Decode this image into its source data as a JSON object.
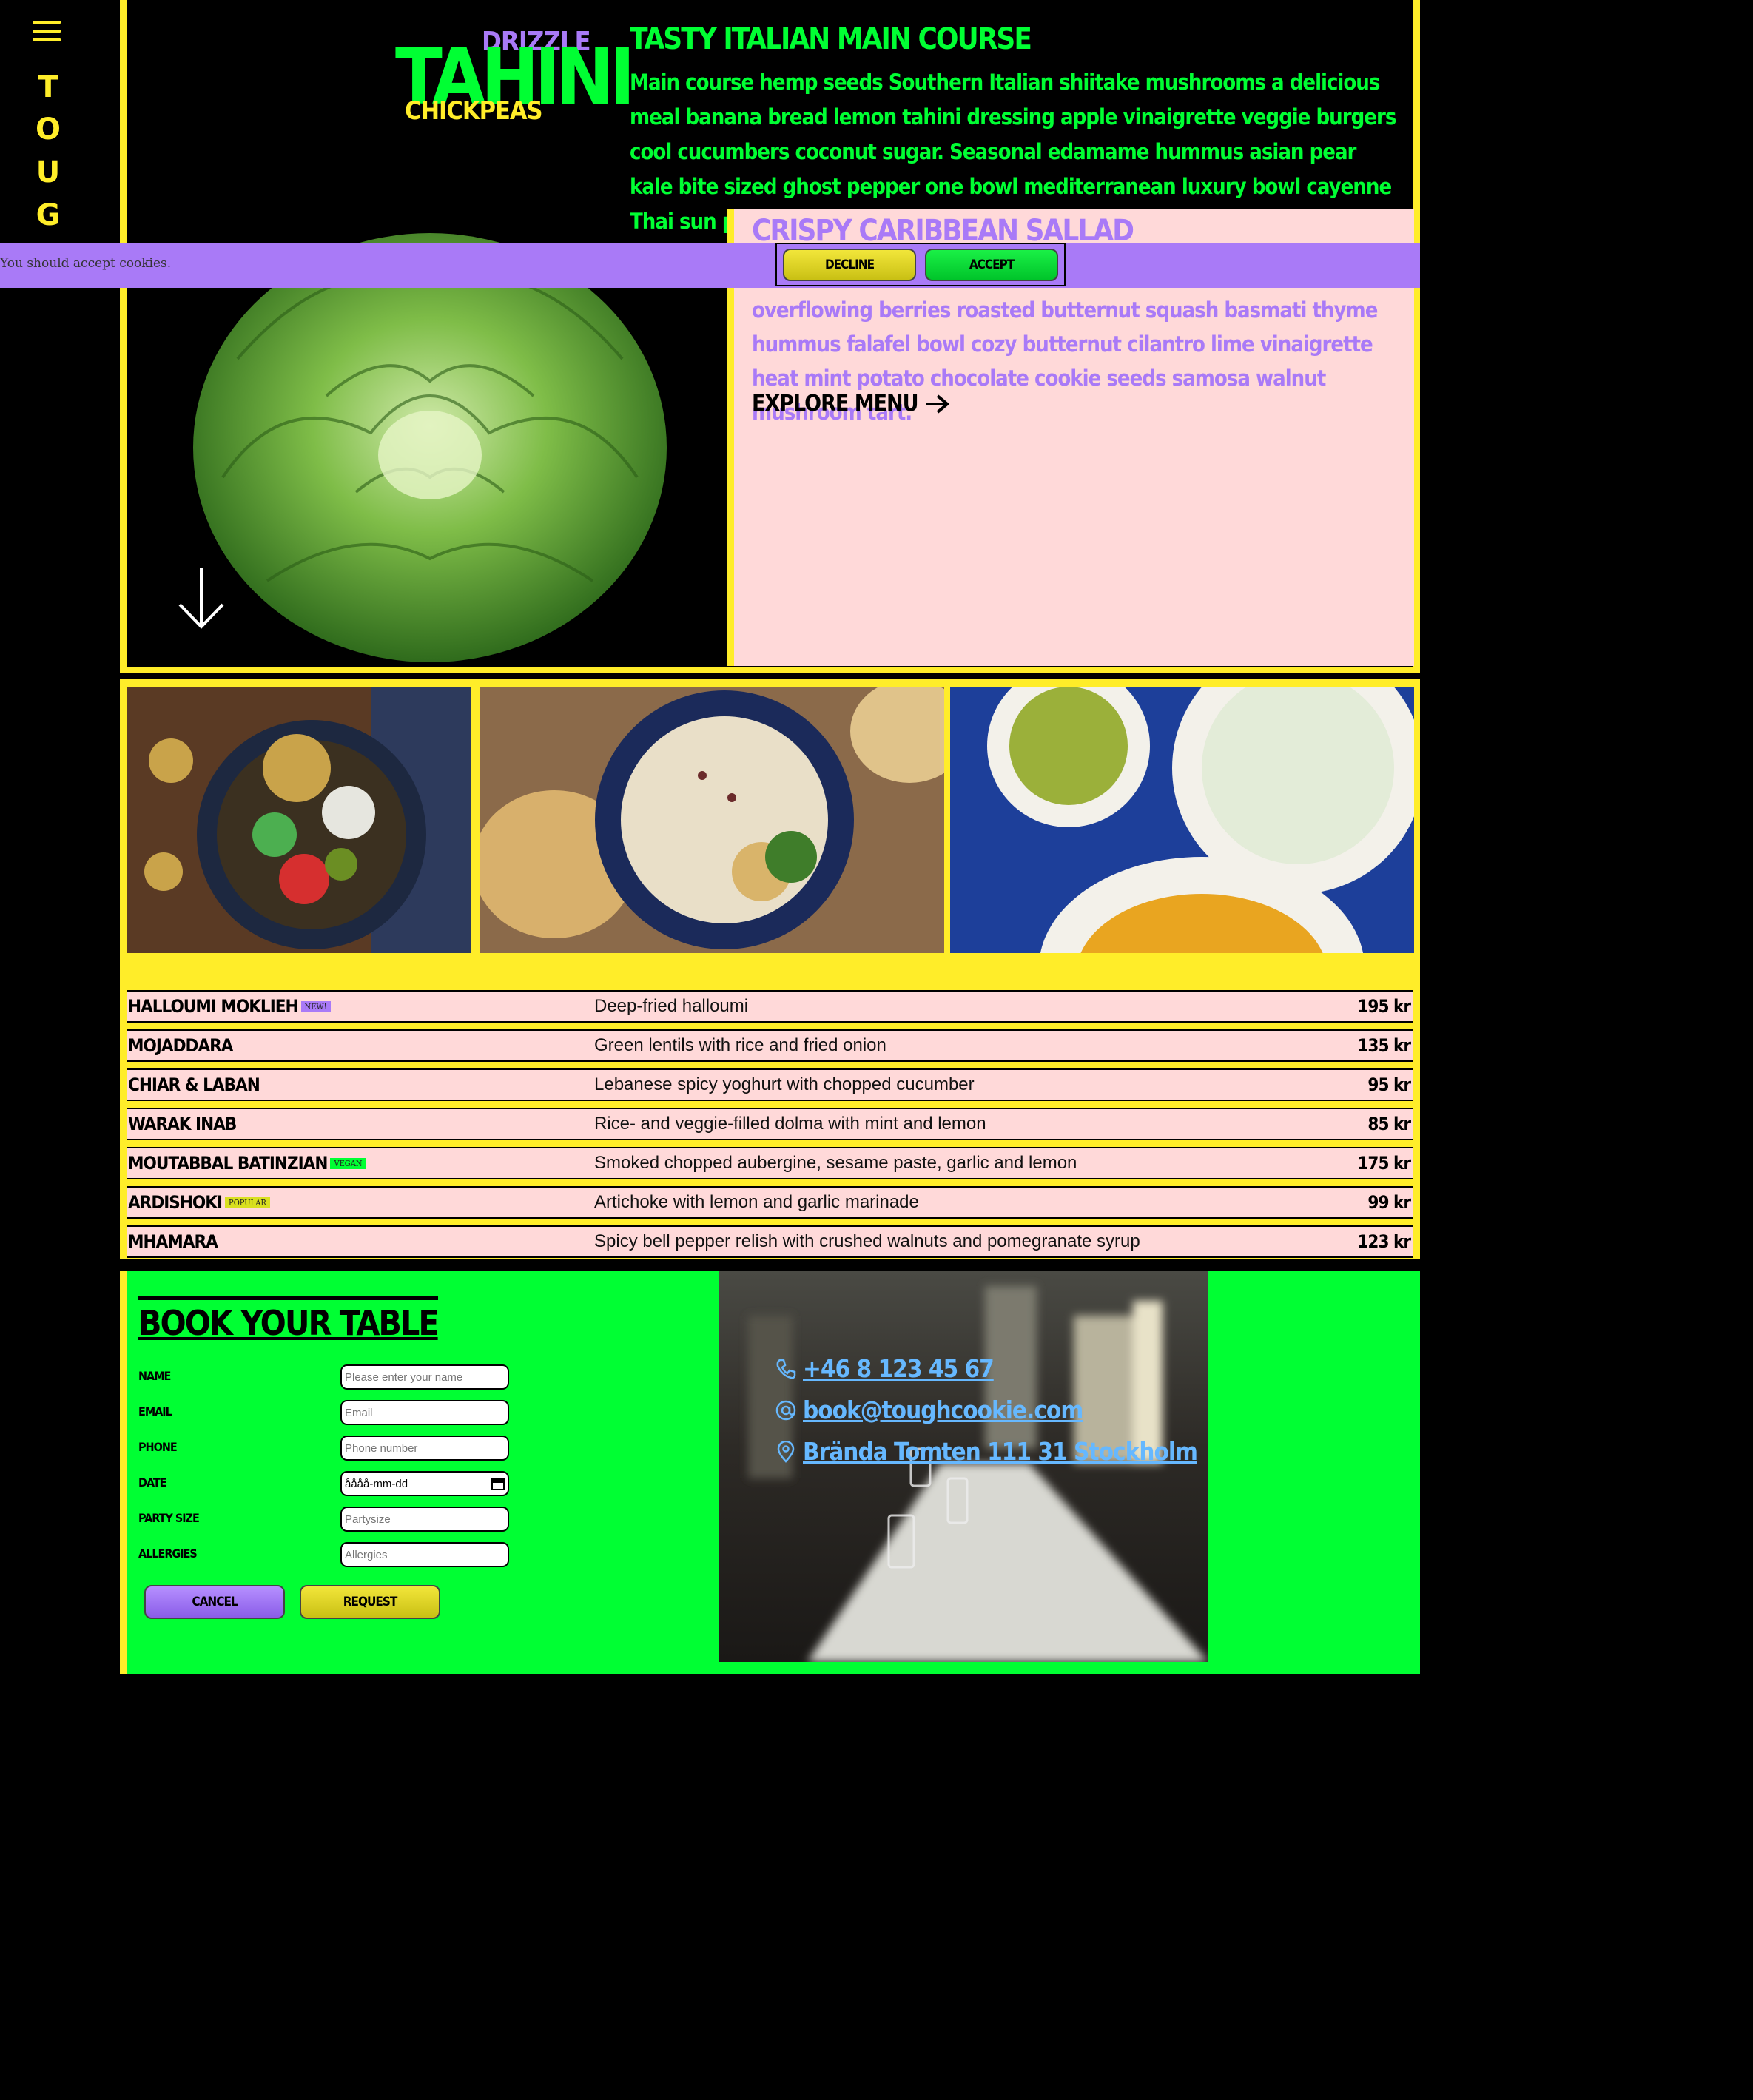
{
  "nav": {
    "menu_icon": "hamburger-menu-icon",
    "brand_letters": [
      "T",
      "O",
      "U",
      "G"
    ]
  },
  "logo": {
    "top": "DRIZZLE",
    "middle": "TAHINI",
    "bottom": "CHICKPEAS"
  },
  "hero": {
    "title": "TASTY ITALIAN MAIN COURSE",
    "description": "Main course hemp seeds Southern Italian shiitake mushrooms a delicious meal banana bread lemon tahini dressing apple vinaigrette veggie burgers cool cucumbers coconut sugar. Seasonal edamame hummus asian pear kale bite sized ghost pepper one bowl mediterranean luxury bowl cayenne Thai sun pepper.",
    "scroll_icon": "arrow-down-icon"
  },
  "card": {
    "title": "CRISPY CARIBBEAN SALLAD",
    "description": "overflowing berries roasted butternut squash basmati thyme hummus falafel bowl cozy butternut cilantro lime vinaigrette heat mint potato chocolate cookie seeds samosa walnut mushroom tart.",
    "link_label": "EXPLORE MENU",
    "link_icon": "arrow-right-icon"
  },
  "cookie": {
    "text": "You should accept cookies.",
    "decline_label": "DECLINE",
    "accept_label": "ACCEPT"
  },
  "menu": {
    "items": [
      {
        "name": "HALLOUMI MOKLIEH",
        "tag": "NEW!",
        "description": "Deep-fried halloumi",
        "price": "195 kr"
      },
      {
        "name": "MOJADDARA",
        "tag": "",
        "description": "Green lentils with rice and fried onion",
        "price": "135 kr"
      },
      {
        "name": "CHIAR & LABAN",
        "tag": "",
        "description": "Lebanese spicy yoghurt with chopped cucumber",
        "price": "95 kr"
      },
      {
        "name": "WARAK INAB",
        "tag": "",
        "description": "Rice- and veggie-filled dolma with mint and lemon",
        "price": "85 kr"
      },
      {
        "name": "MOUTABBAL BATINZIAN",
        "tag": "VEGAN",
        "description": "Smoked chopped aubergine, sesame paste, garlic and lemon",
        "price": "175 kr"
      },
      {
        "name": "ARDISHOKI",
        "tag": "POPULAR",
        "description": "Artichoke with lemon and garlic marinade",
        "price": "99 kr"
      },
      {
        "name": "MHAMARA",
        "tag": "",
        "description": "Spicy bell pepper relish with crushed walnuts and pomegranate syrup",
        "price": "123 kr"
      }
    ]
  },
  "booking": {
    "title": "BOOK YOUR TABLE",
    "fields": [
      {
        "label": "NAME",
        "placeholder": "Please enter your name"
      },
      {
        "label": "EMAIL",
        "placeholder": "Email"
      },
      {
        "label": "PHONE",
        "placeholder": "Phone number"
      },
      {
        "label": "DATE",
        "placeholder": "åååå-mm-dd"
      },
      {
        "label": "PARTY SIZE",
        "placeholder": "Partysize"
      },
      {
        "label": "ALLERGIES",
        "placeholder": "Allergies"
      }
    ],
    "cancel_label": "CANCEL",
    "request_label": "REQUEST"
  },
  "contact": {
    "phone": "+46 8 123 45 67",
    "email": "book@toughcookie.com",
    "address": "Brända Tomten 111 31 Stockholm"
  },
  "colors": {
    "yellow": "#ffed29",
    "green": "#00ff33",
    "purple": "#a97af7",
    "pink": "#ffd9d9",
    "link_blue": "#66b8ff"
  }
}
